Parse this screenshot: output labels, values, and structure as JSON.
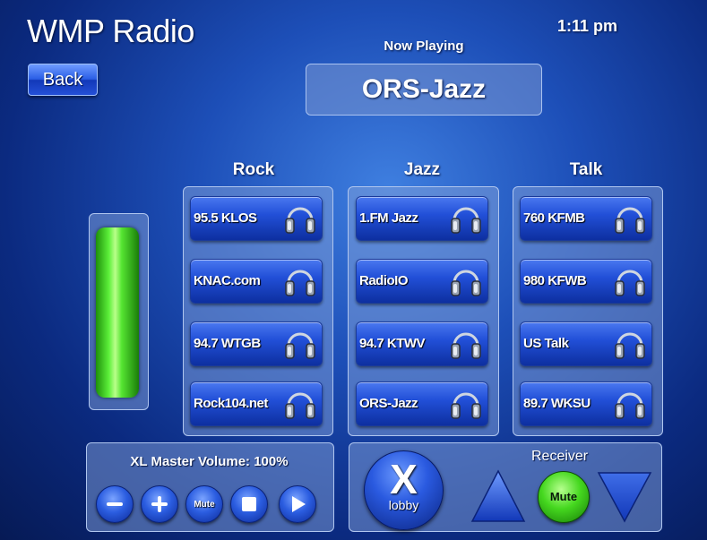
{
  "app": {
    "title": "WMP Radio",
    "time": "1:11 pm"
  },
  "nav": {
    "back_label": "Back"
  },
  "now_playing": {
    "label": "Now Playing",
    "station": "ORS-Jazz"
  },
  "categories": [
    {
      "name": "Rock",
      "stations": [
        "95.5 KLOS",
        "KNAC.com",
        "94.7 WTGB",
        "Rock104.net"
      ]
    },
    {
      "name": "Jazz",
      "stations": [
        "1.FM Jazz",
        "RadioIO",
        "94.7 KTWV",
        "ORS-Jazz"
      ]
    },
    {
      "name": "Talk",
      "stations": [
        "760 KFMB",
        "980 KFWB",
        "US Talk",
        "89.7 WKSU"
      ]
    }
  ],
  "volume": {
    "label": "XL Master Volume: 100%",
    "level": 1.0,
    "mute_label": "Mute"
  },
  "receiver": {
    "label": "Receiver",
    "mute_label": "Mute",
    "lobby_x": "X",
    "lobby_label": "lobby"
  },
  "colors": {
    "accent_green": "#4ee022",
    "button_blue": "#2250d8"
  },
  "icons": [
    "headphones-icon",
    "minus-icon",
    "plus-icon",
    "stop-icon",
    "play-icon",
    "triangle-up-icon",
    "triangle-down-icon"
  ]
}
